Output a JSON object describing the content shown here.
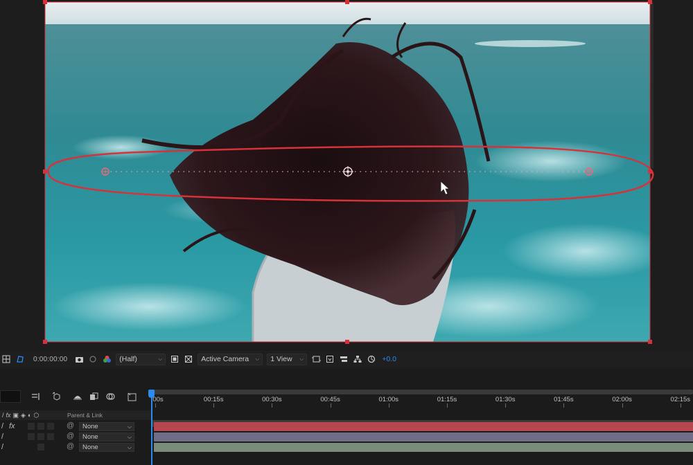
{
  "viewer": {
    "description_free": true,
    "accent_color": "#d7323a"
  },
  "toolbar": {
    "timecode": "0:00:00:00",
    "resolution": "(Half)",
    "camera": "Active Camera",
    "views": "1 View",
    "exposure": "+0.0"
  },
  "timeline": {
    "ruler_labels": [
      "00s",
      "00:15s",
      "00:30s",
      "00:45s",
      "01:00s",
      "01:15s",
      "01:30s",
      "01:45s",
      "02:00s",
      "02:15s"
    ],
    "parent_header": "Parent & Link",
    "layers": [
      {
        "parent": "None",
        "bar_color": "#b8474d"
      },
      {
        "parent": "None",
        "bar_color": "#6e6f86"
      },
      {
        "parent": "None",
        "bar_color": "#7a8c7a"
      }
    ],
    "playhead_color": "#2b8cf0"
  },
  "icons": {
    "toolbar": [
      "grid-icon",
      "mask-icon",
      "snapshot-icon",
      "show-snapshot-icon",
      "channel-icon",
      "region-icon",
      "transparency-grid-icon",
      "fast-preview-icon",
      "3d-view-icon",
      "flowchart-icon",
      "reset-exposure-icon"
    ],
    "timeline_tools": [
      "comp-flowchart-icon",
      "draft-3d-icon",
      "shy-icon",
      "frame-blending-icon",
      "motion-blur-icon",
      "graph-editor-icon"
    ]
  }
}
